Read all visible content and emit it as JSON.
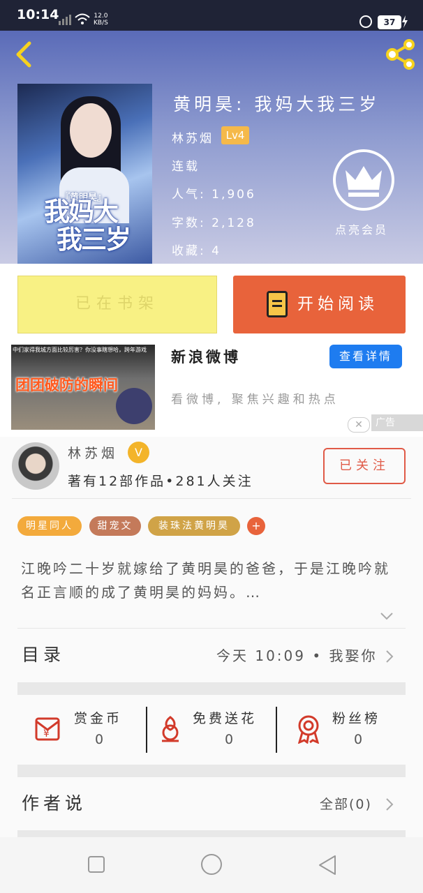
{
  "status_bar": {
    "time": "10:14",
    "net_speed": "12.0",
    "net_unit": "KB/S",
    "battery": "37"
  },
  "book": {
    "title": "黄明昊: 我妈大我三岁",
    "author": "林苏烟",
    "level": "Lv4",
    "status": "连载",
    "popularity": "人气: 1,906",
    "word_count": "字数: 2,128",
    "favorites": "收藏: 4",
    "vip_label": "点亮会员",
    "cover": {
      "tag": "『黄明昊』",
      "title_line1": "我妈大",
      "title_line2": "我三岁"
    }
  },
  "actions": {
    "shelf_label": "已在书架",
    "read_label": "开始阅读"
  },
  "ad": {
    "image_caption": "中们家得我城方面比较厉害？你没事瞎想哈，跨年游戏",
    "image_headline": "团团破防的瞬间",
    "title": "新浪微博",
    "cta": "查看详情",
    "desc": "看微博, 聚焦兴趣和热点",
    "close_symbol": "✕",
    "tag": "广告"
  },
  "author_card": {
    "name": "林苏烟",
    "verified_symbol": "V",
    "stats": "著有12部作品•281人关注",
    "follow_label": "已关注"
  },
  "tags": [
    {
      "label": "明星同人",
      "color": "#f3aa3c"
    },
    {
      "label": "甜宠文",
      "color": "#c47a5a"
    },
    {
      "label": "装珠法黄明昊",
      "color": "#d0a347"
    }
  ],
  "tag_add": "+",
  "synopsis": "江晚吟二十岁就嫁给了黄明昊的爸爸，于是江晚吟就名正言顺的成了黄明昊的妈妈。…",
  "directory": {
    "label": "目录",
    "latest": "今天 10:09 • 我娶你"
  },
  "rewards": [
    {
      "title": "赏金币",
      "count": "0",
      "icon": "red-envelope-icon"
    },
    {
      "title": "免费送花",
      "count": "0",
      "icon": "flower-icon"
    },
    {
      "title": "粉丝榜",
      "count": "0",
      "icon": "medal-icon"
    }
  ],
  "author_says": {
    "label": "作者说",
    "all": "全部(0)"
  },
  "colors": {
    "accent": "#e8633b",
    "shelf": "#f8f184",
    "badge": "#f5b94a",
    "ad_cta": "#1e7cf0"
  }
}
